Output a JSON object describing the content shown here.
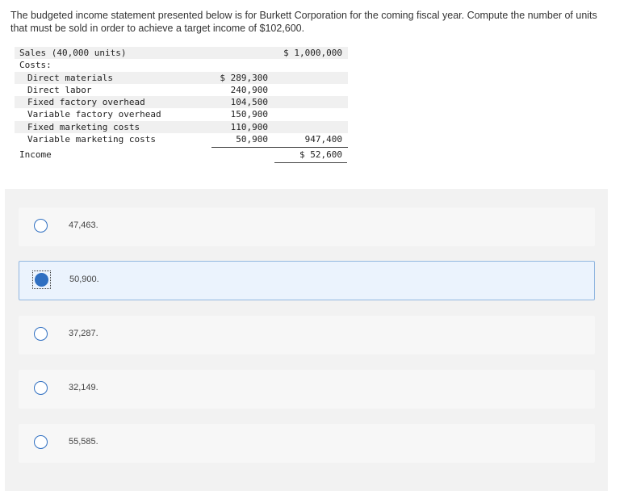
{
  "question": {
    "text": "The budgeted income statement presented below is for Burkett Corporation for the coming fiscal year. Compute the number of units that must be sold in order to achieve a target income of $102,600."
  },
  "statement": {
    "sales_label": "Sales (40,000 units)",
    "sales_total": "$ 1,000,000",
    "costs_label": "Costs:",
    "items": [
      {
        "label": "Direct materials",
        "amount": "$ 289,300"
      },
      {
        "label": "Direct labor",
        "amount": "240,900"
      },
      {
        "label": "Fixed factory overhead",
        "amount": "104,500"
      },
      {
        "label": "Variable factory overhead",
        "amount": "150,900"
      },
      {
        "label": "Fixed marketing costs",
        "amount": "110,900"
      },
      {
        "label": "Variable marketing costs",
        "amount": "50,900"
      }
    ],
    "costs_total": "947,400",
    "income_label": "Income",
    "income_total": "$ 52,600"
  },
  "choices": [
    {
      "text": "47,463.",
      "selected": false
    },
    {
      "text": "50,900.",
      "selected": true
    },
    {
      "text": "37,287.",
      "selected": false
    },
    {
      "text": "32,149.",
      "selected": false
    },
    {
      "text": "55,585.",
      "selected": false
    }
  ],
  "colors": {
    "accent": "#2f6fc1",
    "selected_bg": "#ebf3fd"
  }
}
